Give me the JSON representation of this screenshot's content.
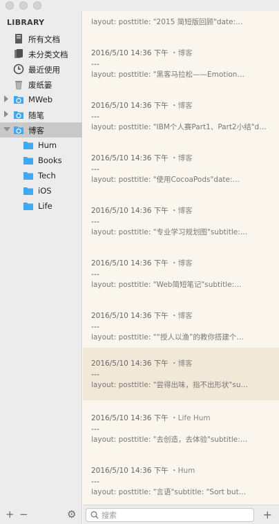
{
  "sidebar": {
    "library_title": "LIBRARY",
    "items": [
      {
        "label": "所有文档"
      },
      {
        "label": "未分类文档"
      },
      {
        "label": "最近使用"
      },
      {
        "label": "废纸篓"
      },
      {
        "label": "MWeb"
      },
      {
        "label": "随笔"
      },
      {
        "label": "博客"
      },
      {
        "label": "Hum"
      },
      {
        "label": "Books"
      },
      {
        "label": "Tech"
      },
      {
        "label": "iOS"
      },
      {
        "label": "Life"
      }
    ],
    "footer": {
      "add": "+",
      "remove": "−",
      "settings": "⚙"
    }
  },
  "entries": [
    {
      "date": "",
      "tag": "",
      "sep": "",
      "body": "layout:     posttitle:     \"2015 简短版回顾\"date:…"
    },
    {
      "date": "2016/5/10 14:36 下午",
      "tag": "・博客",
      "sep": "---",
      "body": "layout:     posttitle:     \"黑客马拉松——Emotion…"
    },
    {
      "date": "2016/5/10 14:36 下午",
      "tag": "・博客",
      "sep": "---",
      "body": "layout: posttitle: \"IBM个人赛Part1、Part2小结\"d…"
    },
    {
      "date": "2016/5/10 14:36 下午",
      "tag": "・博客",
      "sep": "---",
      "body": "layout:     posttitle:     \"使用CocoaPods\"date:…"
    },
    {
      "date": "2016/5/10 14:36 下午",
      "tag": "・博客",
      "sep": "---",
      "body": "layout:     posttitle:     \"专业学习规划图\"subtitle:…"
    },
    {
      "date": "2016/5/10 14:36 下午",
      "tag": "・博客",
      "sep": "---",
      "body": "layout:     posttitle:     \"Web简短笔记\"subtitle:…"
    },
    {
      "date": "2016/5/10 14:36 下午",
      "tag": "・博客",
      "sep": "---",
      "body": "layout:     posttitle:     \"“授人以渔”的教你搭建个…"
    },
    {
      "date": "2016/5/10 14:36 下午",
      "tag": "・博客",
      "sep": "---",
      "body": "layout:     posttitle:     \"尝得出味，指不出形状\"su…"
    },
    {
      "date": "2016/5/10 14:36 下午",
      "tag": "・Life Hum",
      "sep": "---",
      "body": "layout:     posttitle:     \"去创造，去体验\"subtitle:…"
    },
    {
      "date": "2016/5/10 14:36 下午",
      "tag": "・Hum",
      "sep": "---",
      "body": "layout:     posttitle:     \"言语\"subtitle:    \"Sort but…"
    }
  ],
  "search": {
    "placeholder": "搜索",
    "value": ""
  },
  "add_note": "+",
  "colors": {
    "folder": "#3fa9f5",
    "highlight_row": "#f1e8d8",
    "list_bg": "#faf6ee",
    "sidebar_bg": "#ececec"
  }
}
